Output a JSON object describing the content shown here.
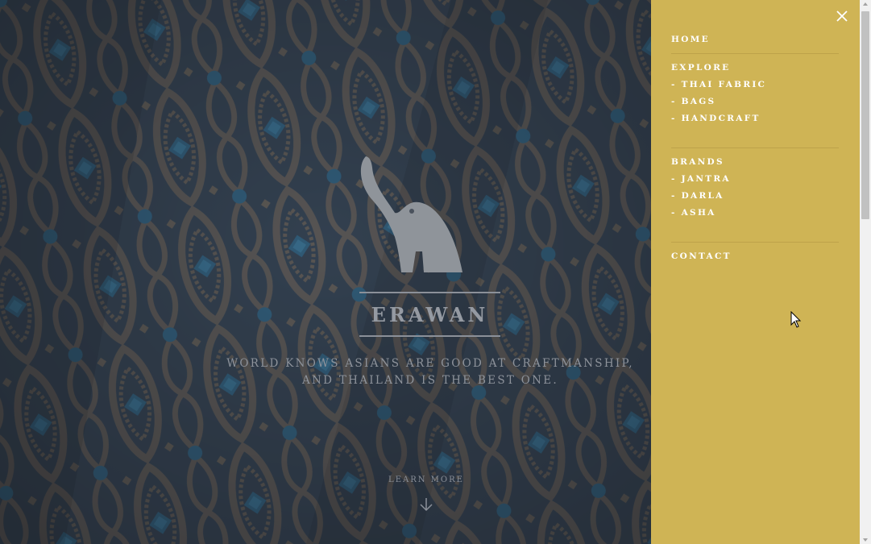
{
  "hero": {
    "logo_icon": "elephant-icon",
    "brand": "ERAWAN",
    "tagline_line1": "WORLD KNOWS ASIANS ARE GOOD AT CRAFTMANSHIP,",
    "tagline_line2": "AND THAILAND IS THE BEST ONE.",
    "learn_more": "LEARN MORE",
    "arrow_icon": "arrow-down-icon"
  },
  "menu": {
    "close_icon": "close-icon",
    "home": "HOME",
    "explore": {
      "heading": "EXPLORE",
      "items": [
        "- THAI FABRIC",
        "- BAGS",
        "- HANDCRAFT"
      ]
    },
    "brands": {
      "heading": "BRANDS",
      "items": [
        "- JANTRA",
        "- DARLA",
        "- ASHA"
      ]
    },
    "contact": "CONTACT"
  },
  "colors": {
    "menu_bg": "#cfb455",
    "menu_text": "#ffffff",
    "hero_overlay": "#3a4450",
    "hero_text": "#959aa2"
  }
}
